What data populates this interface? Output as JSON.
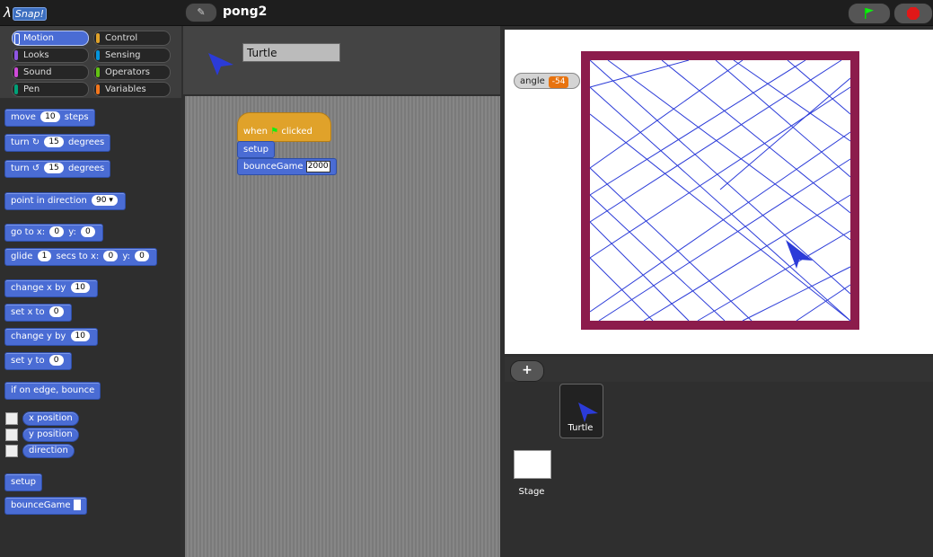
{
  "app": {
    "title": "pong2",
    "edit_icon": "pencil-icon",
    "logo_text": "Snap!"
  },
  "categories": [
    {
      "label": "Motion",
      "color": "#4a6cd4",
      "selected": true
    },
    {
      "label": "Control",
      "color": "#e0a22a"
    },
    {
      "label": "Looks",
      "color": "#8f56e3"
    },
    {
      "label": "Sensing",
      "color": "#0494dc"
    },
    {
      "label": "Sound",
      "color": "#cf4ad9"
    },
    {
      "label": "Operators",
      "color": "#62c213"
    },
    {
      "label": "Pen",
      "color": "#00a178"
    },
    {
      "label": "Variables",
      "color": "#f3761d"
    }
  ],
  "palette": {
    "move": {
      "a": "move",
      "v": "10",
      "b": "steps"
    },
    "turn_cw": {
      "a": "turn",
      "v": "15",
      "b": "degrees"
    },
    "turn_ccw": {
      "a": "turn",
      "v": "15",
      "b": "degrees"
    },
    "point": {
      "a": "point in direction",
      "v": "90"
    },
    "goto": {
      "a": "go to x:",
      "x": "0",
      "b": "y:",
      "y": "0"
    },
    "glide": {
      "a": "glide",
      "v": "1",
      "b": "secs to x:",
      "x": "0",
      "c": "y:",
      "y": "0"
    },
    "change_x": {
      "a": "change x by",
      "v": "10"
    },
    "set_x": {
      "a": "set x to",
      "v": "0"
    },
    "change_y": {
      "a": "change y by",
      "v": "10"
    },
    "set_y": {
      "a": "set y to",
      "v": "0"
    },
    "bounce": {
      "a": "if on edge, bounce"
    },
    "x_position": "x position",
    "y_position": "y position",
    "direction": "direction",
    "setup": "setup",
    "bounceGame": "bounceGame"
  },
  "sprite": {
    "name": "Turtle"
  },
  "script": {
    "hat_when": "when",
    "hat_clicked": "clicked",
    "setup": "setup",
    "bounce": "bounceGame",
    "bounce_value": "2000"
  },
  "watcher": {
    "label": "angle",
    "value": "-54"
  },
  "corral": {
    "sprite_label": "Turtle",
    "stage_label": "Stage",
    "add_label": "+"
  },
  "colors": {
    "arena_border": "#8c1c4c",
    "pen": "#2b3bd8",
    "sprite": "#2b3bd8"
  }
}
